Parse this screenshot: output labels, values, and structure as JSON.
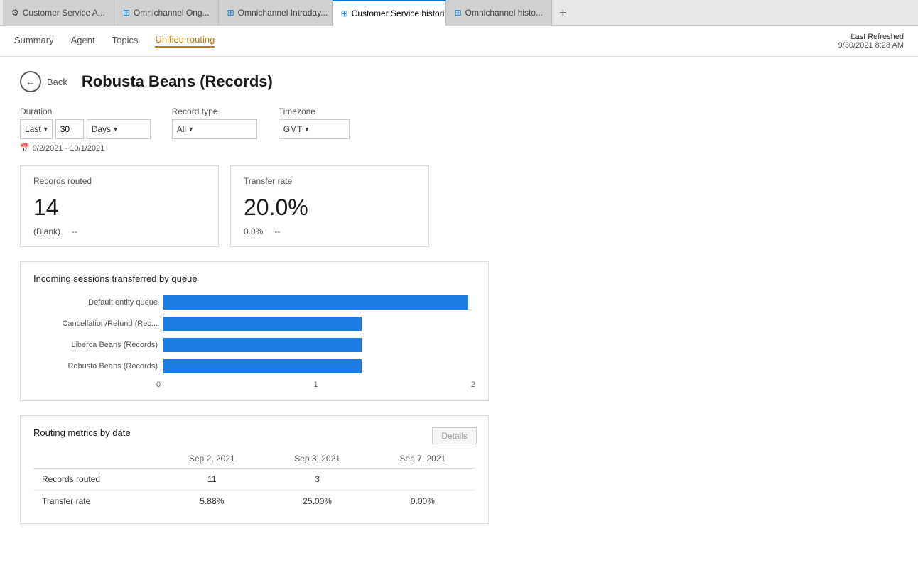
{
  "tabs": [
    {
      "id": "tab1",
      "icon": "⚙",
      "label": "Customer Service A...",
      "active": false,
      "closable": false
    },
    {
      "id": "tab2",
      "icon": "⊞",
      "label": "Omnichannel Ong...",
      "active": false,
      "closable": false
    },
    {
      "id": "tab3",
      "icon": "⊞",
      "label": "Omnichannel Intraday...",
      "active": false,
      "closable": false
    },
    {
      "id": "tab4",
      "icon": "⊞",
      "label": "Customer Service historic...",
      "active": true,
      "closable": true
    },
    {
      "id": "tab5",
      "icon": "⊞",
      "label": "Omnichannel histo...",
      "active": false,
      "closable": false
    }
  ],
  "nav": {
    "links": [
      {
        "id": "summary",
        "label": "Summary",
        "active": false
      },
      {
        "id": "agent",
        "label": "Agent",
        "active": false
      },
      {
        "id": "topics",
        "label": "Topics",
        "active": false
      },
      {
        "id": "unified-routing",
        "label": "Unified routing",
        "active": true
      }
    ],
    "last_refreshed_label": "Last Refreshed",
    "last_refreshed_value": "9/30/2021 8:28 AM"
  },
  "page": {
    "back_label": "Back",
    "title": "Robusta Beans (Records)"
  },
  "filters": {
    "duration_label": "Duration",
    "duration_prefix": "Last",
    "duration_value": "30",
    "duration_unit": "Days",
    "record_type_label": "Record type",
    "record_type_value": "All",
    "timezone_label": "Timezone",
    "timezone_value": "GMT",
    "date_range": "9/2/2021 - 10/1/2021"
  },
  "kpi": {
    "records_routed": {
      "title": "Records routed",
      "value": "14",
      "sub_label1": "(Blank)",
      "sub_value1": "--"
    },
    "transfer_rate": {
      "title": "Transfer rate",
      "value": "20.0%",
      "sub_label1": "0.0%",
      "sub_value1": "--"
    }
  },
  "chart": {
    "title": "Incoming sessions transferred by queue",
    "bars": [
      {
        "label": "Default entity queue",
        "value": 2,
        "max": 2
      },
      {
        "label": "Cancellation/Refund (Rec...",
        "value": 1.3,
        "max": 2
      },
      {
        "label": "Liberca Beans (Records)",
        "value": 1.3,
        "max": 2
      },
      {
        "label": "Robusta Beans (Records)",
        "value": 1.3,
        "max": 2
      }
    ],
    "x_axis": [
      "0",
      "1",
      "2"
    ]
  },
  "routing_table": {
    "title": "Routing metrics by date",
    "details_btn_label": "Details",
    "columns": [
      "",
      "Sep 2, 2021",
      "Sep 3, 2021",
      "Sep 7, 2021"
    ],
    "rows": [
      {
        "label": "Records routed",
        "values": [
          "11",
          "3",
          ""
        ]
      },
      {
        "label": "Transfer rate",
        "values": [
          "5.88%",
          "25.00%",
          "0.00%"
        ]
      }
    ]
  }
}
